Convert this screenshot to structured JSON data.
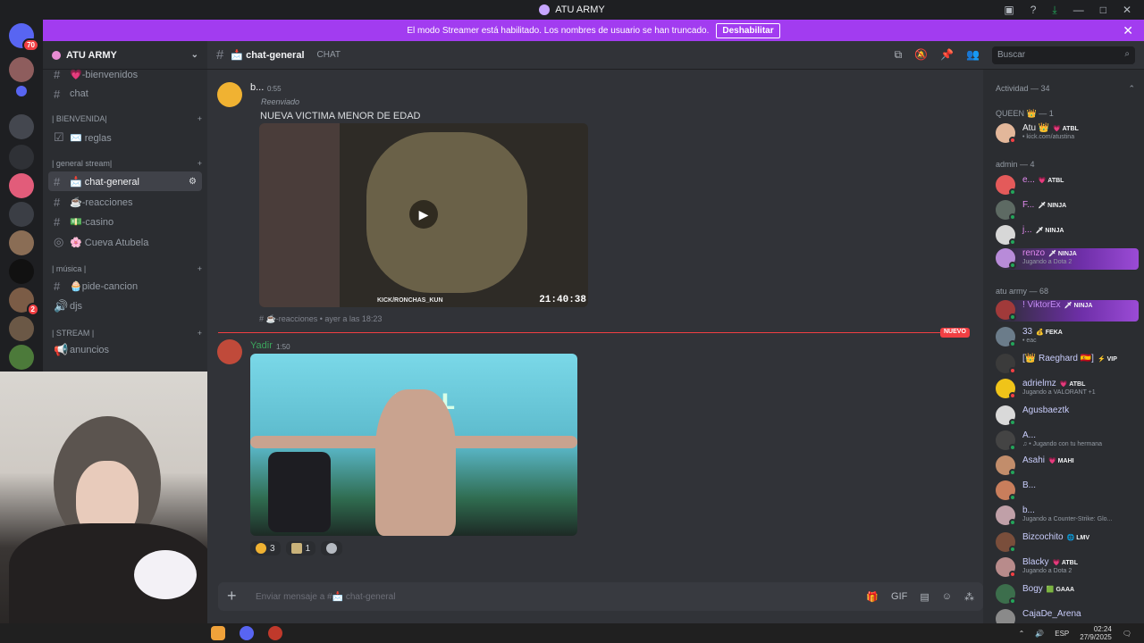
{
  "window": {
    "title": "ATU ARMY"
  },
  "banner": {
    "text": "El modo Streamer está habilitado. Los nombres de usuario se han truncado.",
    "button": "Deshabilitar"
  },
  "serverbar": {
    "home_badge": "70",
    "dm_badge": "2"
  },
  "guild": {
    "name": "ATU ARMY"
  },
  "channels": {
    "items": [
      {
        "label": "💗-bienvenidos"
      },
      {
        "label": "chat"
      },
      {
        "label": "| BIENVENIDA|"
      },
      {
        "label": "✉️ reglas"
      },
      {
        "label": "| general stream|"
      },
      {
        "label": "📩 chat-general"
      },
      {
        "label": "☕-reacciones"
      },
      {
        "label": "💵-casino"
      },
      {
        "label": "🌸 Cueva Atubela"
      },
      {
        "label": "| música |"
      },
      {
        "label": "🧁pide-cancion"
      },
      {
        "label": "djs"
      },
      {
        "label": "| STREAM |"
      },
      {
        "label": "anuncios"
      }
    ]
  },
  "topbar": {
    "channel": "📩 chat-general",
    "type": "CHAT",
    "search_placeholder": "Buscar"
  },
  "messages": {
    "m1": {
      "author": "b...",
      "time": "0:55",
      "forwarded": "Reenviado",
      "text": "NUEVA VICTIMA MENOR DE EDAD",
      "video_stamp": "21:40:38",
      "video_watermark": "KICK/RONCHAS_KUN",
      "source": "# ☕-reacciones • ayer a las 18:23"
    },
    "divider_label": "NUEVO",
    "m2": {
      "author": "Yadir",
      "time": "1:50",
      "image_text": "ERAL",
      "reactions": [
        {
          "count": "3"
        },
        {
          "count": "1"
        }
      ]
    }
  },
  "composer": {
    "placeholder": "Enviar mensaje a #📩 chat-general"
  },
  "members": {
    "activity": "Actividad — 34",
    "groups": [
      {
        "title": "QUEEN 👑 — 1"
      },
      {
        "title": "admin — 4"
      },
      {
        "title": "atu army — 68"
      }
    ],
    "list": [
      {
        "name": "Atu 👑",
        "tag": "💗 ATBL",
        "activity": "• kick.com/atustina"
      },
      {
        "name": "e...",
        "tag": "💗 ATBL",
        "activity": ""
      },
      {
        "name": "F...",
        "tag": "🗡 NINJA",
        "activity": ""
      },
      {
        "name": "j...",
        "tag": "🗡 NINJA",
        "activity": ""
      },
      {
        "name": "renzo",
        "tag": "🗡 NINJA",
        "activity": "Jugando a Dota 2"
      },
      {
        "name": "! ViktorEx",
        "tag": "🗡 NINJA",
        "activity": ""
      },
      {
        "name": "33",
        "tag": "💰 FEKA",
        "activity": "• eac"
      },
      {
        "name": "[👑 Raeghard 🇪🇸]",
        "tag": "⚡ VIP",
        "activity": ""
      },
      {
        "name": "adrielmz",
        "tag": "💗 ATBL",
        "activity": "Jugando a VALORANT +1"
      },
      {
        "name": "Agusbaeztk",
        "tag": "",
        "activity": ""
      },
      {
        "name": "A...",
        "tag": "",
        "activity": "♫ • Jugando con tu hermana"
      },
      {
        "name": "Asahi",
        "tag": "💗 MAHI",
        "activity": ""
      },
      {
        "name": "B...",
        "tag": "",
        "activity": ""
      },
      {
        "name": "b...",
        "tag": "",
        "activity": "Jugando a Counter-Strike: Glo..."
      },
      {
        "name": "Bizcochito",
        "tag": "🌐 LMV",
        "activity": ""
      },
      {
        "name": "Blacky",
        "tag": "💗 ATBL",
        "activity": "Jugando a Dota 2"
      },
      {
        "name": "Bogy",
        "tag": "🟩 GAAA",
        "activity": ""
      },
      {
        "name": "CajaDe_Arena",
        "tag": "",
        "activity": ""
      }
    ]
  },
  "taskbar": {
    "lang": "ESP",
    "time": "02:24",
    "date": "27/9/2025"
  },
  "colors": {
    "accent": "#a23cf0",
    "online": "#23a55a",
    "unread": "#f23f43"
  }
}
